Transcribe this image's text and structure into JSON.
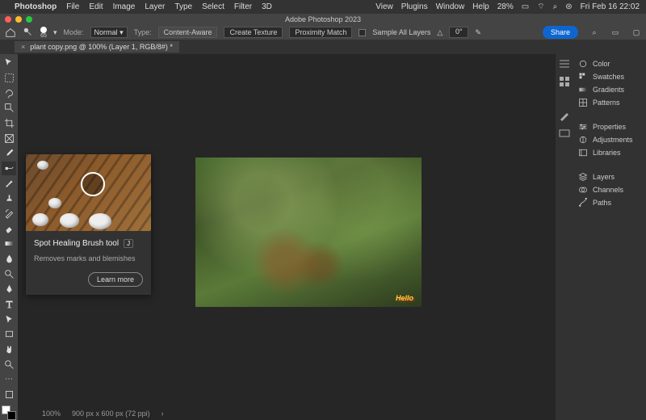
{
  "menubar": {
    "app": "Photoshop",
    "items": [
      "File",
      "Edit",
      "Image",
      "Layer",
      "Type",
      "Select",
      "Filter",
      "3D"
    ],
    "right_items": [
      "View",
      "Plugins",
      "Window",
      "Help"
    ],
    "battery": "28%",
    "clock": "Fri Feb 16  22:02"
  },
  "window_title": "Adobe Photoshop 2023",
  "options": {
    "brush_size": "65",
    "mode_label": "Mode:",
    "mode_value": "Normal",
    "type_label": "Type:",
    "content_aware": "Content-Aware",
    "create_texture": "Create Texture",
    "proximity_match": "Proximity Match",
    "sample_all": "Sample All Layers",
    "angle": "0°",
    "share": "Share"
  },
  "tab": {
    "label": "plant copy.png @ 100% (Layer 1, RGB/8#) *"
  },
  "tooltip": {
    "title": "Spot Healing Brush tool",
    "key": "J",
    "desc": "Removes marks and blemishes",
    "learn": "Learn more"
  },
  "doc_watermark": "Hello",
  "panels": {
    "color": "Color",
    "swatches": "Swatches",
    "gradients": "Gradients",
    "patterns": "Patterns",
    "properties": "Properties",
    "adjustments": "Adjustments",
    "libraries": "Libraries",
    "layers": "Layers",
    "channels": "Channels",
    "paths": "Paths"
  },
  "status": {
    "zoom": "100%",
    "dims": "900 px x 600 px (72 ppi)"
  }
}
